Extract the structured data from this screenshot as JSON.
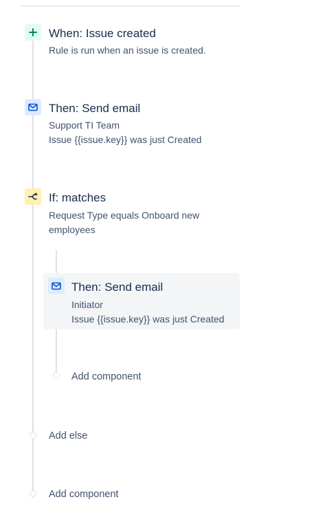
{
  "rule": {
    "trigger": {
      "title": "When: Issue created",
      "description": "Rule is run when an issue is created.",
      "icon": "plus-icon",
      "color": "#00875a"
    },
    "action_send_email": {
      "title": "Then: Send email",
      "recipient": "Support TI Team",
      "subject": "Issue {{issue.key}} was just Created",
      "icon": "envelope-icon",
      "color": "#0052cc"
    },
    "condition": {
      "title": "If: matches",
      "description_line1": "Request Type equals Onboard new",
      "description_line2": "employees",
      "icon": "branch-icon",
      "color": "#172b4d",
      "nested_action": {
        "title": "Then: Send email",
        "recipient": "Initiator",
        "subject": "Issue {{issue.key}} was just Created",
        "icon": "envelope-icon"
      },
      "nested_add_component": "Add component"
    },
    "add_else": "Add else",
    "add_component": "Add component"
  }
}
